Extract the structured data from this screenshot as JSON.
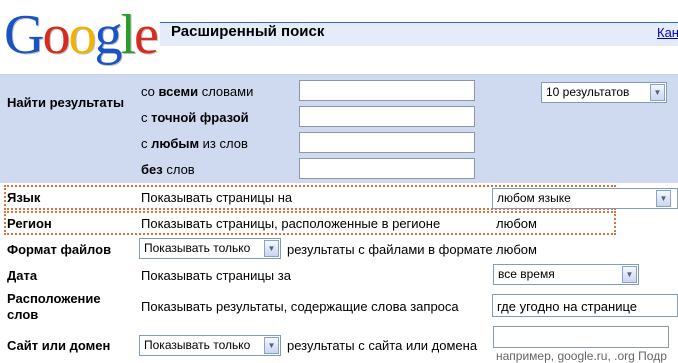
{
  "logo": {
    "letters": [
      "G",
      "o",
      "o",
      "g",
      "l",
      "e"
    ],
    "colors": [
      "#1a53c6",
      "#d62b1e",
      "#f0b400",
      "#1a53c6",
      "#2a9c2a",
      "#d62b1e"
    ]
  },
  "header": {
    "title": "Расширенный поиск",
    "link_partial": "Кан"
  },
  "find": {
    "label": "Найти результаты",
    "rows": [
      {
        "pre": "со ",
        "bold": "всеми",
        "post": " словами"
      },
      {
        "pre": "с ",
        "bold": "точной фразой",
        "post": ""
      },
      {
        "pre": "с ",
        "bold": "любым",
        "post": " из слов"
      },
      {
        "pre": "",
        "bold": "без",
        "post": " слов"
      }
    ],
    "results_select": "10 результатов"
  },
  "language": {
    "label": "Язык",
    "text": "Показывать страницы на",
    "value": "любом языке"
  },
  "region": {
    "label": "Регион",
    "text": "Показывать страницы, расположенные в регионе",
    "value": "любом"
  },
  "format": {
    "label": "Формат файлов",
    "select": "Показывать только",
    "text": "результаты с файлами в формате",
    "value": "любом"
  },
  "date": {
    "label": "Дата",
    "text": "Показывать страницы за",
    "value": "все время"
  },
  "location": {
    "label_line1": "Расположение",
    "label_line2": "слов",
    "text": "Показывать результаты, содержащие слова запроса",
    "value": "где угодно на странице"
  },
  "site": {
    "label": "Сайт или домен",
    "select": "Показывать только",
    "text": "результаты с сайта или домена",
    "hint": "например, google.ru, .org  Подр"
  },
  "colors": {
    "accent_blue": "#3366cc",
    "section_bg": "#cfdaf0",
    "highlight_border": "#d9733e"
  }
}
